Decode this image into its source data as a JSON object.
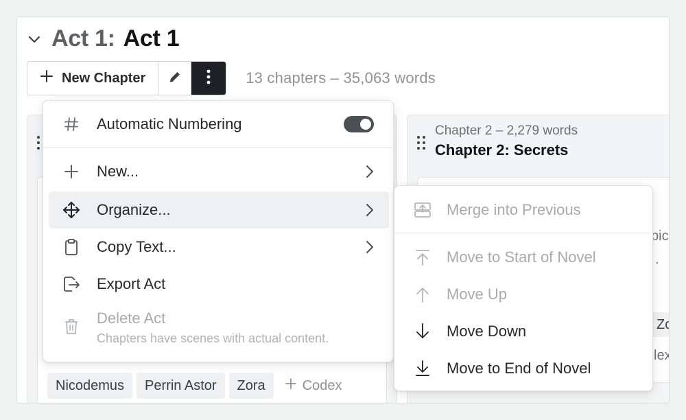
{
  "act": {
    "prefix": "Act 1:",
    "title": "Act 1",
    "new_chapter_label": "New Chapter",
    "stats": "13 chapters  –  35,063 words"
  },
  "chapter_card": {
    "meta": "Chapter 2  –  2,279 words",
    "title": "Chapter 2: Secrets"
  },
  "codex_tags": [
    "Nicodemus",
    "Perrin Astor",
    "Zora"
  ],
  "codex_add_label": "Codex",
  "menu": {
    "automatic_numbering_label": "Automatic Numbering",
    "automatic_numbering_on": true,
    "new_label": "New...",
    "organize_label": "Organize...",
    "copy_text_label": "Copy Text...",
    "export_label": "Export Act",
    "delete_label": "Delete Act",
    "delete_note": "Chapters have scenes with actual content."
  },
  "organize_submenu": {
    "merge_label": "Merge into Previous",
    "move_start_label": "Move to Start of Novel",
    "move_up_label": "Move Up",
    "move_down_label": "Move Down",
    "move_end_label": "Move to End of Novel"
  },
  "peek": {
    "text_a": "pic",
    "text_b": ".",
    "chip_a": "Zo",
    "chip_b": "lex"
  },
  "colors": {
    "page_bg": "#eef3f2",
    "dark_button": "#1d2125",
    "muted_text": "#8d9296",
    "disabled_text": "#a7abae"
  }
}
